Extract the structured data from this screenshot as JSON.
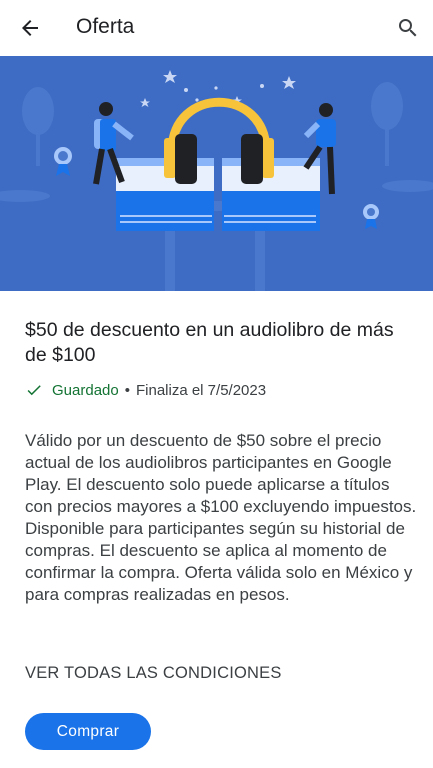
{
  "appbar": {
    "title": "Oferta",
    "back_icon": "arrow-back-icon",
    "search_icon": "search-icon"
  },
  "offer": {
    "headline": "$50 de descuento en un audiolibro de más de $100",
    "status_saved": "Guardado",
    "status_separator": "•",
    "status_ends": "Finaliza el 7/5/2023",
    "description": "Válido por un descuento de $50 sobre el precio actual de los audiolibros participantes en Google Play. El descuento solo puede aplicarse a títulos con precios mayores a $100 excluyendo impuestos. Disponible para participantes según su historial de compras. El descuento se aplica al momento de confirmar la compra. Oferta válida solo en México y para compras realizadas en pesos.",
    "terms_link": "VER TODAS LAS CONDICIONES",
    "buy_button": "Comprar"
  },
  "colors": {
    "banner_bg": "#3e6cc4",
    "saved_green": "#137333",
    "primary_blue": "#1a73e8",
    "headphones_yellow": "#f6c33b"
  }
}
